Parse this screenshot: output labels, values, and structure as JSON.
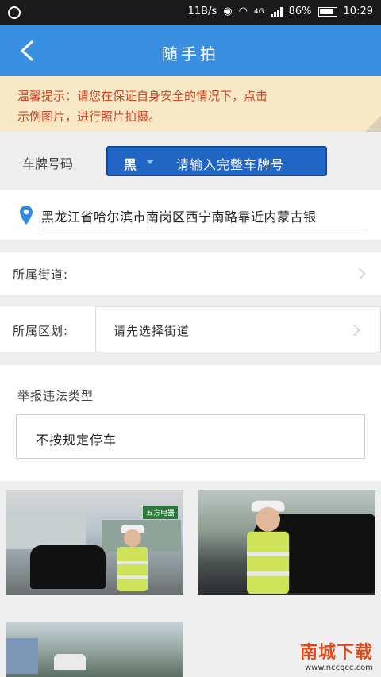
{
  "status_bar": {
    "speed": "11B/s",
    "network": "4G",
    "battery": "86%",
    "time": "10:29"
  },
  "header": {
    "title": "随手拍",
    "back_icon": "chevron-left-icon"
  },
  "tip": {
    "text_line1": "温馨提示：请您在保证自身安全的情况下，点击",
    "text_line2": "示例图片，进行照片拍摄。"
  },
  "plate": {
    "label": "车牌号码",
    "province": "黑",
    "placeholder": "请输入完整车牌号"
  },
  "address": {
    "icon": "location-pin-icon",
    "value": "黑龙江省哈尔滨市南岗区西宁南路靠近内蒙古银"
  },
  "street": {
    "label": "所属街道:"
  },
  "district": {
    "label": "所属区划:",
    "placeholder": "请先选择街道"
  },
  "report": {
    "label": "举报违法类型",
    "type": "不按规定停车"
  },
  "photos": {
    "sign_text": "五方电器"
  },
  "watermark": {
    "text": "南城下载",
    "sub": "www.nccgcc.com"
  },
  "colors": {
    "primary": "#3a8fe0",
    "plate_box": "#2166c4",
    "tip_bg": "#f7e8c6",
    "tip_text": "#c9492a"
  }
}
